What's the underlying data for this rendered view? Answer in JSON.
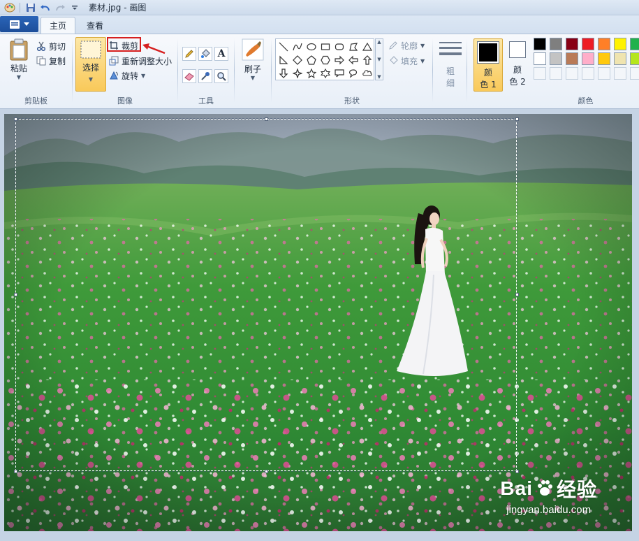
{
  "window": {
    "title": "素材.jpg - 画图"
  },
  "tabs": [
    {
      "label": "主页",
      "active": true
    },
    {
      "label": "查看",
      "active": false
    }
  ],
  "clipboard": {
    "paste_label": "粘贴",
    "cut_label": "剪切",
    "copy_label": "复制",
    "group_label": "剪贴板"
  },
  "image_group": {
    "select_label": "选择",
    "crop_label": "裁剪",
    "resize_label": "重新调整大小",
    "rotate_label": "旋转",
    "group_label": "图像"
  },
  "tools": {
    "text_glyph": "A",
    "group_label": "工具"
  },
  "brush": {
    "label": "刷子"
  },
  "shapes": {
    "outline_label": "轮廓",
    "fill_label": "填充",
    "group_label": "形状"
  },
  "size": {
    "label_line1": "粗",
    "label_line2": "细"
  },
  "colors": {
    "color1_line1": "颜",
    "color1_line2": "色 1",
    "color2_line1": "颜",
    "color2_line2": "色 2",
    "group_label": "颜色",
    "color1_value": "#000000",
    "color2_value": "#ffffff",
    "palette_row1": [
      "#000000",
      "#7f7f7f",
      "#880015",
      "#ed1c24",
      "#ff7f27",
      "#fff200",
      "#22b14c"
    ],
    "palette_row2": [
      "#ffffff",
      "#c3c3c3",
      "#b97a57",
      "#ffaec9",
      "#ffc90e",
      "#efe4b0",
      "#b5e61d"
    ]
  },
  "watermark": {
    "brand": "Bai",
    "brand_suffix": "经验",
    "url": "jingyan.baidu.com"
  }
}
